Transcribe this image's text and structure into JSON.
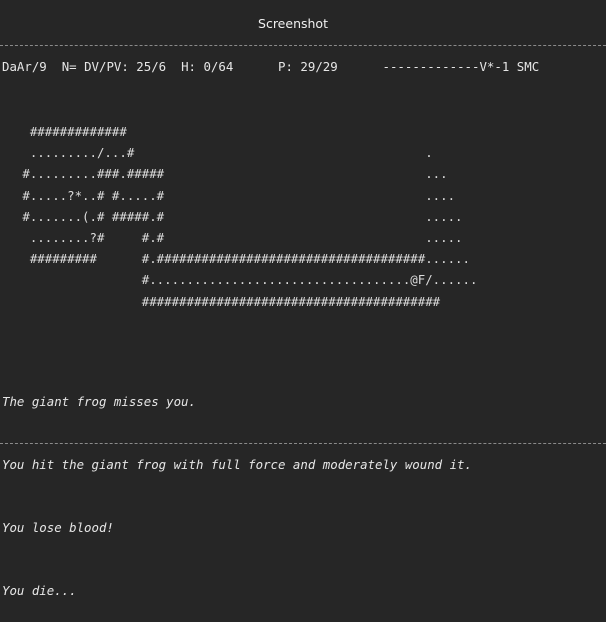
{
  "window": {
    "title": "Screenshot"
  },
  "status": {
    "character": "DaAr/9",
    "nutrition": "N=",
    "dvpv": "DV/PV: 25/6",
    "health": "H: 0/64",
    "power": "P: 29/29",
    "location": "-------------V*-1 SMC"
  },
  "map": {
    "rows": [
      "    #############",
      "    ........./...#                                       .",
      "   #.........###.#####                                   ...",
      "   #.....?*..# #.....#                                   ....",
      "   #.......(.# #####.#                                   .....",
      "    ........?#     #.#                                   .....",
      "    #########      #.####################################......",
      "                   #...................................@F/......",
      "                   ########################################"
    ]
  },
  "messages": [
    "The giant frog misses you.",
    "You hit the giant frog with full force and moderately wound it.",
    "You lose blood!",
    "You die..."
  ]
}
